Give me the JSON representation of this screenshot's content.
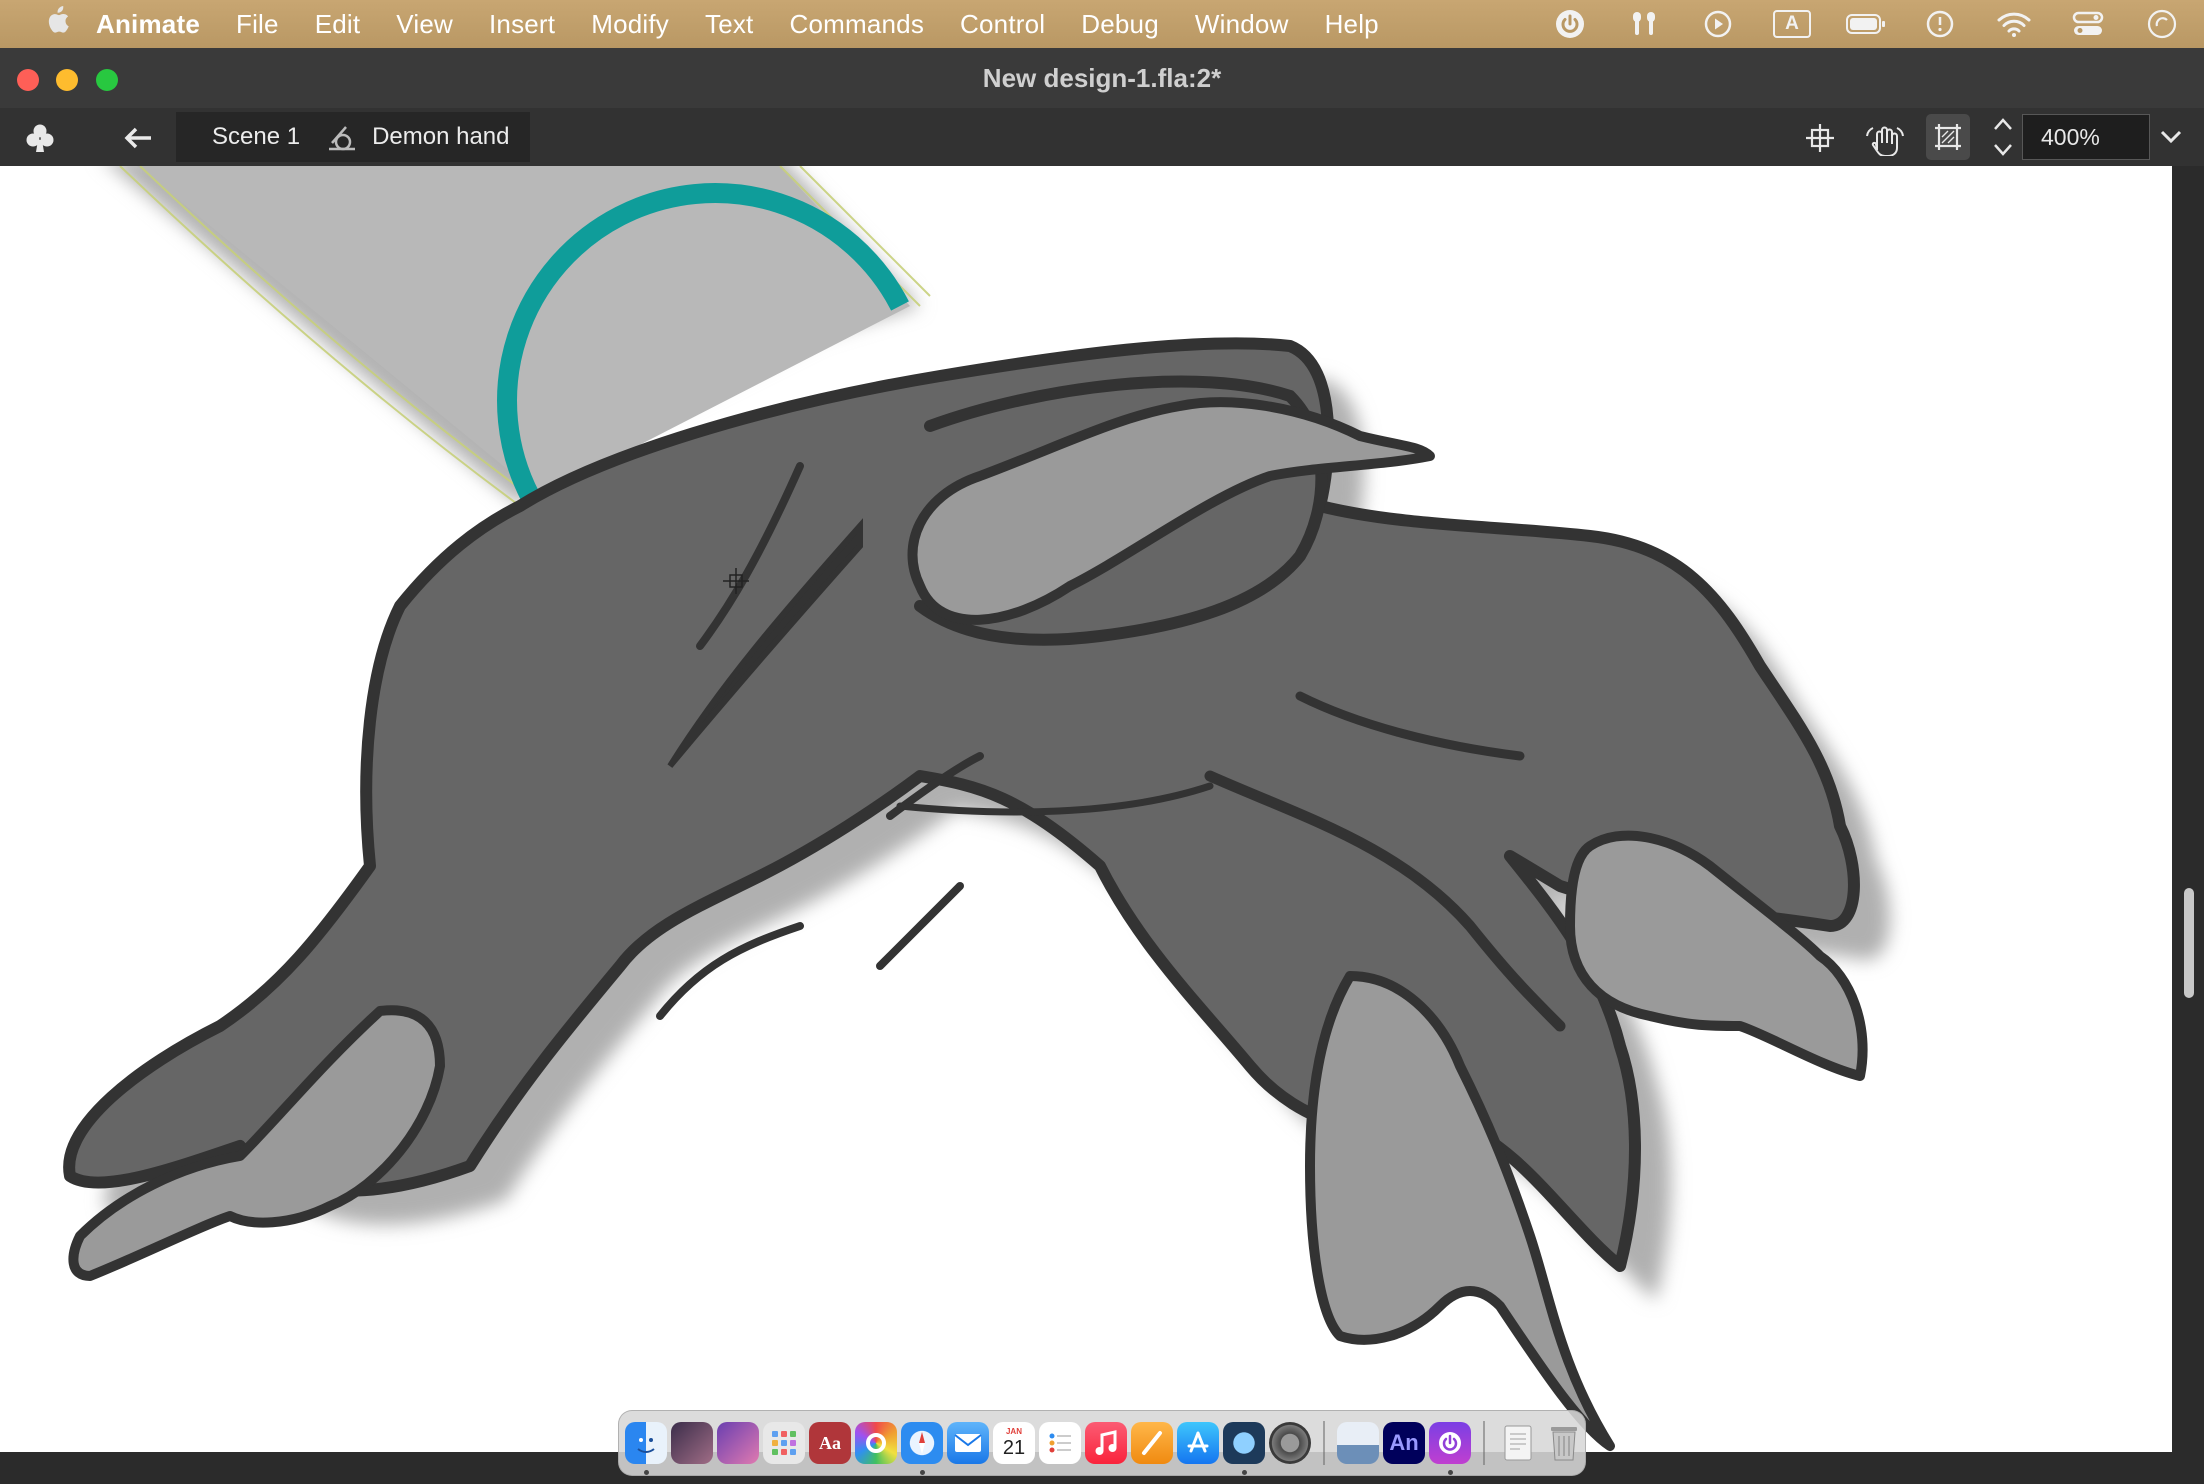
{
  "menubar": {
    "app_name": "Animate",
    "items": [
      "File",
      "Edit",
      "View",
      "Insert",
      "Modify",
      "Text",
      "Commands",
      "Control",
      "Debug",
      "Window",
      "Help"
    ],
    "status_icons": [
      "power-icon",
      "airpods-icon",
      "play-circle-icon",
      "input-source-icon",
      "battery-icon",
      "clock-icon",
      "wifi-icon",
      "control-center-icon",
      "siri-icon"
    ],
    "input_source_label": "A"
  },
  "window": {
    "title": "New design-1.fla:2*"
  },
  "editbar": {
    "scene_label": "Scene 1",
    "symbol_label": "Demon hand",
    "zoom_value": "400%"
  },
  "stage": {
    "symbol": "demon-hand-artwork",
    "colors": {
      "hand_fill": "#666666",
      "claw_fill": "#9a9a9a",
      "outline": "#333333",
      "shadow": "#b0b0b0",
      "ring": "#0f9d9a"
    }
  },
  "dock": {
    "calendar_month": "JAN",
    "calendar_day": "21",
    "dictionary_label": "Aa",
    "animate_label": "An",
    "apps": [
      "finder",
      "photo-app",
      "anime-app",
      "launchpad",
      "dictionary",
      "creative-cloud",
      "safari",
      "mail",
      "calendar",
      "reminders",
      "music",
      "pages",
      "app-store",
      "quicktime",
      "system-preferences",
      "preview",
      "animate",
      "power-app",
      "document",
      "trash"
    ]
  }
}
